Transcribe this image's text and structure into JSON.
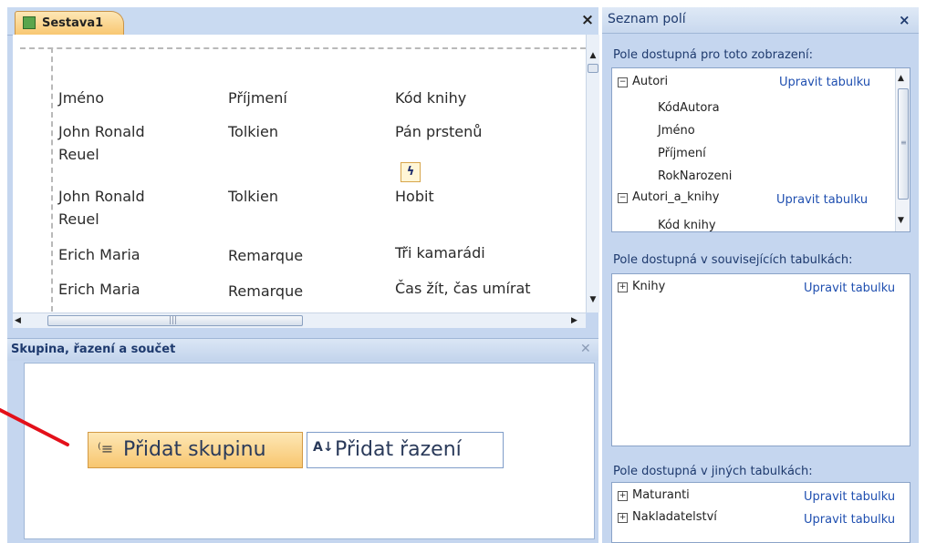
{
  "report": {
    "tab_label": "Sestava1",
    "close_glyph": "×",
    "columns": [
      "Jméno",
      "Příjmení",
      "Kód knihy"
    ],
    "rows": [
      {
        "first": "John Ronald",
        "first2": "Reuel",
        "last": "Tolkien",
        "book": "Pán prstenů"
      },
      {
        "first": "John Ronald",
        "first2": "Reuel",
        "last": "Tolkien",
        "book": "Hobit"
      },
      {
        "first": "Erich Maria",
        "last": "Remarque",
        "book": "Tři kamarádi"
      },
      {
        "first": "Erich Maria",
        "last": "Remarque",
        "book": "Čas žít, čas umírat"
      }
    ],
    "lightning_glyph": "ϟ"
  },
  "scroll": {
    "up": "▲",
    "down": "▼",
    "left": "◀",
    "right": "▶",
    "grip": "|||",
    "vgrip": "≡"
  },
  "group_panel": {
    "title": "Skupina, řazení a součet",
    "close_glyph": "✕",
    "add_group_label": "Přidat skupinu",
    "add_group_icon": "⁽≡",
    "add_sort_label": "Přidat řazení",
    "add_sort_icon": "A↓"
  },
  "field_list": {
    "title": "Seznam polí",
    "close_glyph": "×",
    "section1_label": "Pole dostupná pro toto zobrazení:",
    "section2_label": "Pole dostupná v souvisejících tabulkách:",
    "section3_label": "Pole dostupná v jiných tabulkách:",
    "edit_label": "Upravit tabulku",
    "minus": "−",
    "plus": "+",
    "table1": "Autori",
    "table1_fields": [
      "KódAutora",
      "Jméno",
      "Příjmení",
      "RokNarozeni"
    ],
    "table2": "Autori_a_knihy",
    "table2_fields": [
      "Kód knihy"
    ],
    "related_tables": [
      "Knihy"
    ],
    "other_tables": [
      "Maturanti",
      "Nakladatelství"
    ]
  },
  "colors": {
    "accent": "#f8c66f",
    "pane_bg": "#c5d6ef",
    "link": "#1f4fb0",
    "annotation": "#e3101a"
  }
}
